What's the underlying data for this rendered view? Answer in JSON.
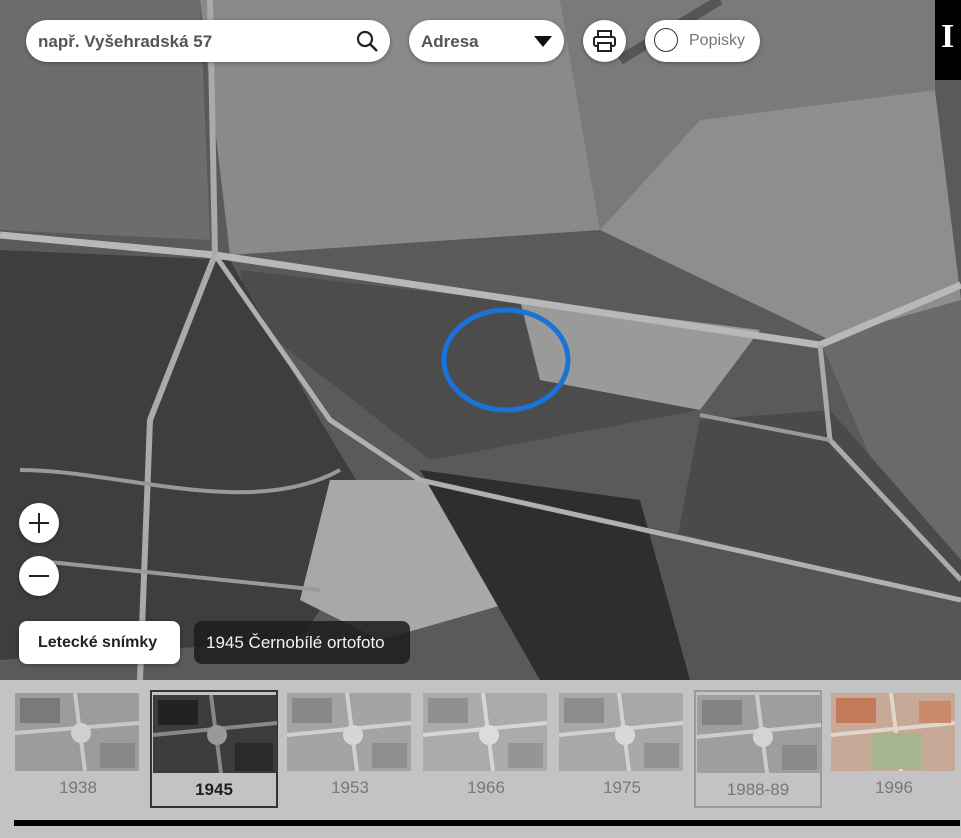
{
  "search": {
    "placeholder": "např. Vyšehradská 57"
  },
  "search_type": {
    "value": "Adresa"
  },
  "labels_toggle": {
    "label": "Popisky",
    "checked": false
  },
  "logo": {
    "text": "I"
  },
  "zoom": {
    "in_label": "+",
    "out_label": "−"
  },
  "layers": {
    "button_label": "Letecké snímky",
    "active_layer": "1945 Černobílé ortofoto"
  },
  "timeline": [
    {
      "year": "1938",
      "selected": false,
      "highlight": false,
      "colored": false
    },
    {
      "year": "1945",
      "selected": true,
      "highlight": false,
      "colored": false
    },
    {
      "year": "1953",
      "selected": false,
      "highlight": false,
      "colored": false
    },
    {
      "year": "1966",
      "selected": false,
      "highlight": false,
      "colored": false
    },
    {
      "year": "1975",
      "selected": false,
      "highlight": false,
      "colored": false
    },
    {
      "year": "1988-89",
      "selected": false,
      "highlight": true,
      "colored": false
    },
    {
      "year": "1996",
      "selected": false,
      "highlight": false,
      "colored": true
    }
  ],
  "colors": {
    "highlight_circle": "#1a73d9",
    "timeline_bg": "#ebebeb",
    "selected_border": "#333333"
  }
}
